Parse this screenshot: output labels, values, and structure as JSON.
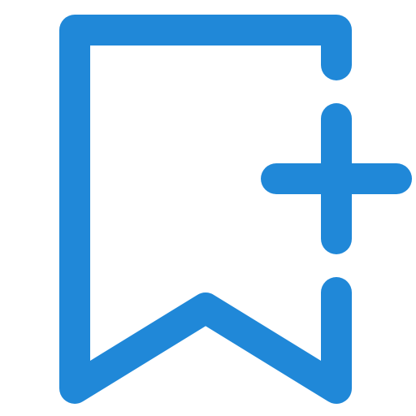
{
  "icon": {
    "name": "bookmark-add-icon",
    "color": "#2088D8"
  }
}
